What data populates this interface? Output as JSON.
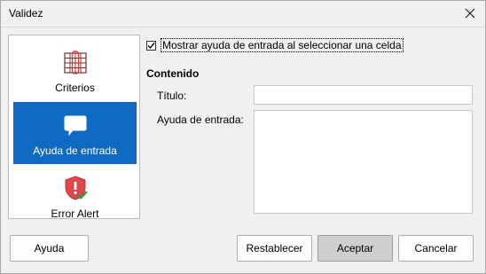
{
  "window": {
    "title": "Validez"
  },
  "tabs": [
    {
      "label": "Criterios",
      "icon": "criteria-grid-icon"
    },
    {
      "label": "Ayuda de entrada",
      "icon": "speech-bubble-icon",
      "active": true
    },
    {
      "label": "Error Alert",
      "icon": "shield-warning-icon"
    }
  ],
  "options": {
    "show_help_label": "Mostrar ayuda de entrada al seleccionar una celda",
    "show_help_checked": true
  },
  "content": {
    "section_title": "Contenido",
    "title_label": "Título:",
    "title_value": "",
    "help_label": "Ayuda de entrada:",
    "help_value": ""
  },
  "buttons": {
    "help": "Ayuda",
    "reset": "Restablecer",
    "accept": "Aceptar",
    "cancel": "Cancelar"
  },
  "colors": {
    "accent": "#0f6ac1",
    "shield": "#e0474c",
    "check": "#2e9e3e"
  }
}
